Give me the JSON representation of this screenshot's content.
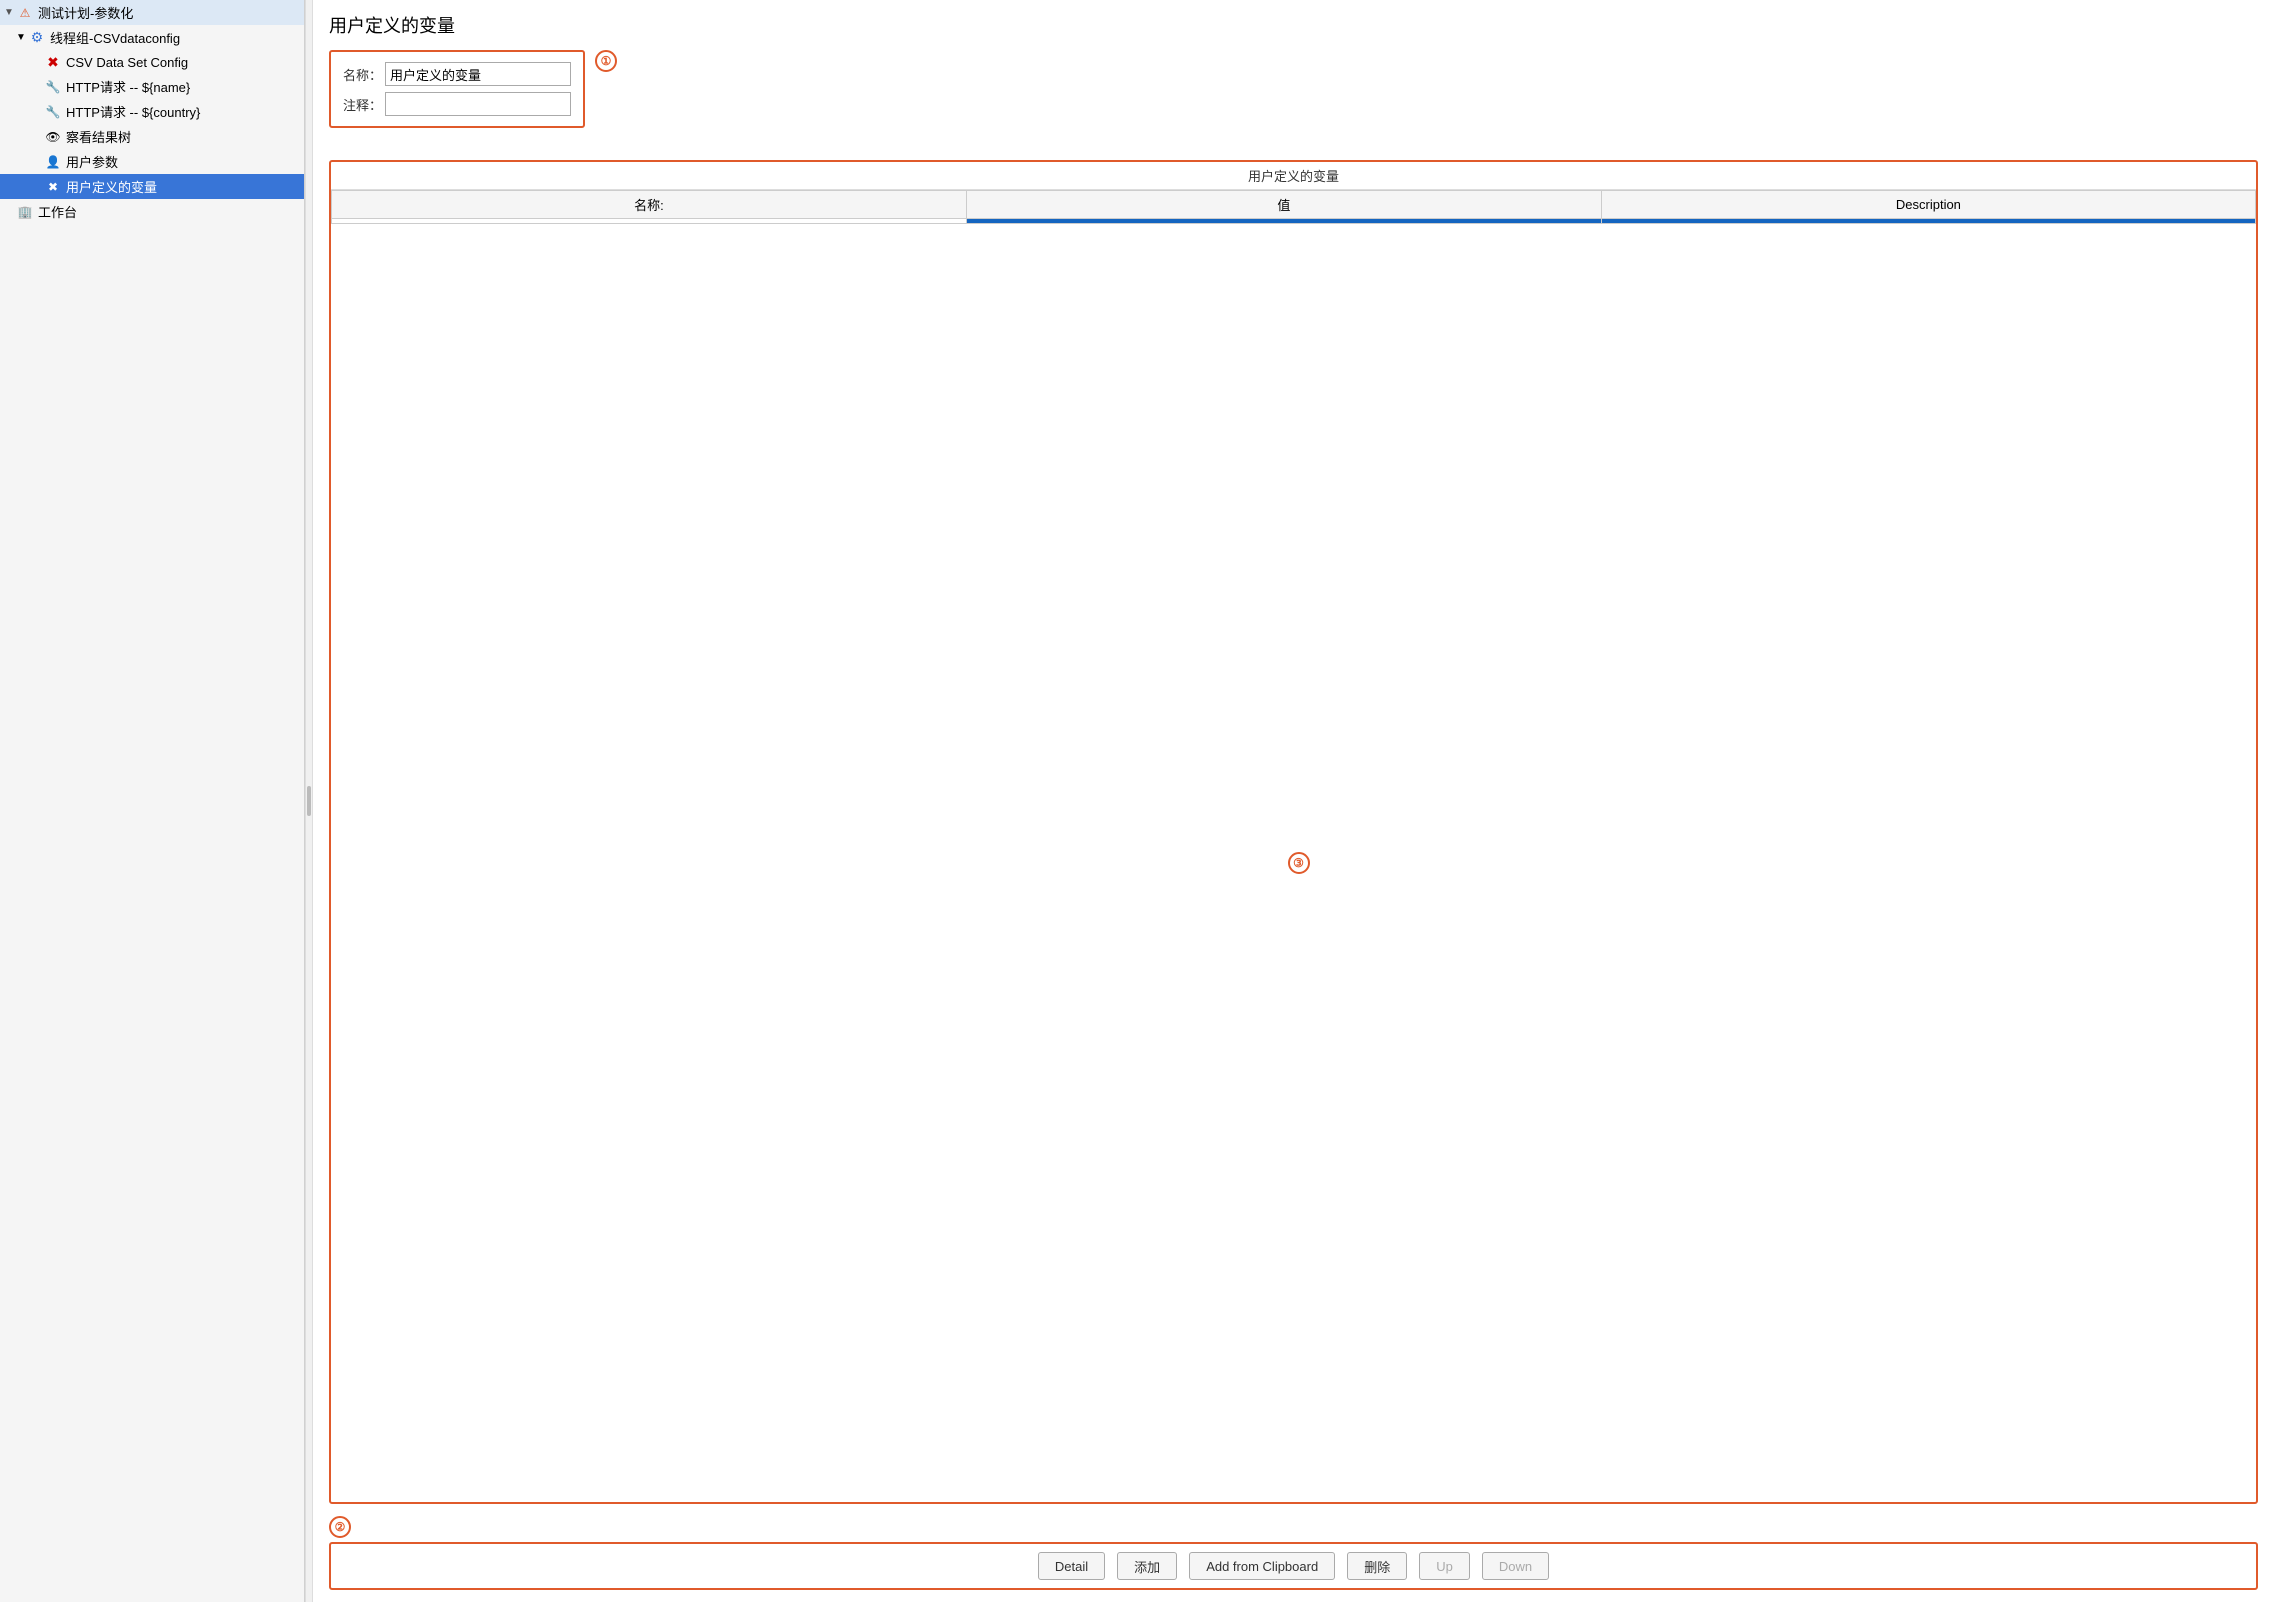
{
  "page_title": "用户定义的变量",
  "form": {
    "name_label": "名称：",
    "name_value": "用户定义的变量",
    "comment_label": "注释：",
    "comment_value": "",
    "annotation_1": "①"
  },
  "table": {
    "section_title": "用户定义的变量",
    "columns": [
      "名称:",
      "值",
      "Description"
    ],
    "rows": [
      {
        "name": "",
        "value": "",
        "description": ""
      }
    ],
    "annotation_3": "③"
  },
  "toolbar": {
    "annotation_2": "②",
    "detail_label": "Detail",
    "add_label": "添加",
    "add_clipboard_label": "Add from Clipboard",
    "delete_label": "删除",
    "up_label": "Up",
    "down_label": "Down"
  },
  "sidebar": {
    "root_label": "测试计划-参数化",
    "thread_group_label": "线程组-CSVdataconfig",
    "csv_label": "CSV Data Set Config",
    "http1_label": "HTTP请求 -- ${name}",
    "http2_label": "HTTP请求 -- ${country}",
    "view_label": "察看结果树",
    "user_params_label": "用户参数",
    "user_vars_label": "用户定义的变量",
    "workbench_label": "工作台"
  },
  "icons": {
    "triangle": "▼",
    "gear": "⚙",
    "lightning": "⚡",
    "wrench": "🔧",
    "eye": "👁",
    "user": "👤",
    "x": "✖",
    "building": "🏢",
    "arrow_right": "▶",
    "arrow_down": "▼"
  }
}
